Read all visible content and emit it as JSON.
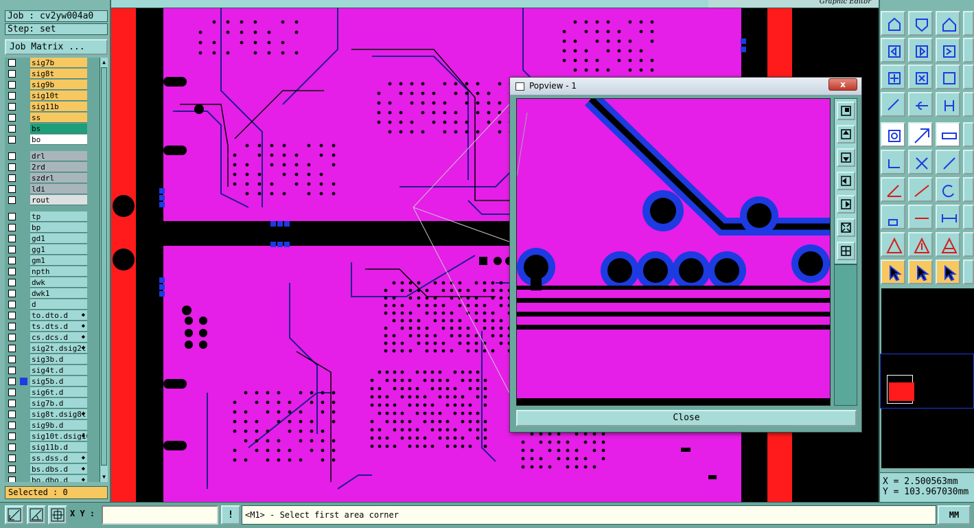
{
  "job": {
    "label": "Job : cv2yw004a0",
    "step": "Step: set",
    "matrix_button": "Job Matrix ..."
  },
  "layers": [
    {
      "name": "sig7b",
      "color": "#f7c760",
      "mark": ""
    },
    {
      "name": "sig8t",
      "color": "#f7c760",
      "mark": ""
    },
    {
      "name": "sig9b",
      "color": "#f7c760",
      "mark": ""
    },
    {
      "name": "sig10t",
      "color": "#f7c760",
      "mark": ""
    },
    {
      "name": "sig11b",
      "color": "#f7c760",
      "mark": ""
    },
    {
      "name": "ss",
      "color": "#f7c760",
      "mark": ""
    },
    {
      "name": "bs",
      "color": "#1f9e7a",
      "mark": ""
    },
    {
      "name": "bo",
      "color": "#ffffff",
      "mark": ""
    },
    {
      "name": "drl",
      "color": "#a8b6bc",
      "mark": ""
    },
    {
      "name": "2rd",
      "color": "#a8b6bc",
      "mark": ""
    },
    {
      "name": "szdrl",
      "color": "#a8b6bc",
      "mark": ""
    },
    {
      "name": "ldi",
      "color": "#a8b6bc",
      "mark": ""
    },
    {
      "name": "rout",
      "color": "#dde0e0",
      "mark": ""
    },
    {
      "name": "tp",
      "color": "#9fd8d4",
      "mark": ""
    },
    {
      "name": "bp",
      "color": "#9fd8d4",
      "mark": ""
    },
    {
      "name": "gd1",
      "color": "#9fd8d4",
      "mark": ""
    },
    {
      "name": "gg1",
      "color": "#9fd8d4",
      "mark": ""
    },
    {
      "name": "gm1",
      "color": "#9fd8d4",
      "mark": ""
    },
    {
      "name": "npth",
      "color": "#9fd8d4",
      "mark": ""
    },
    {
      "name": "dwk",
      "color": "#9fd8d4",
      "mark": ""
    },
    {
      "name": "dwk1",
      "color": "#9fd8d4",
      "mark": ""
    },
    {
      "name": "d",
      "color": "#9fd8d4",
      "mark": ""
    },
    {
      "name": "to.d",
      "color": "#9fd8d4",
      "mark": "◆"
    },
    {
      "name": "ts.d",
      "color": "#9fd8d4",
      "mark": "◆"
    },
    {
      "name": "cs.d",
      "color": "#9fd8d4",
      "mark": "◆"
    },
    {
      "name": "sig2t.d",
      "color": "#9fd8d4",
      "mark": "◆"
    },
    {
      "name": "sig3b.d",
      "color": "#9fd8d4",
      "mark": ""
    },
    {
      "name": "sig4t.d",
      "color": "#9fd8d4",
      "mark": ""
    },
    {
      "name": "sig5b.d",
      "color": "#9fd8d4",
      "mark": "",
      "selected": true
    },
    {
      "name": "sig6t.d",
      "color": "#9fd8d4",
      "mark": ""
    },
    {
      "name": "sig7b.d",
      "color": "#9fd8d4",
      "mark": ""
    },
    {
      "name": "sig8t.d",
      "color": "#9fd8d4",
      "mark": "◆"
    },
    {
      "name": "sig9b.d",
      "color": "#9fd8d4",
      "mark": ""
    },
    {
      "name": "sig10t.d",
      "color": "#9fd8d4",
      "mark": "◆"
    },
    {
      "name": "sig11b.d",
      "color": "#9fd8d4",
      "mark": ""
    },
    {
      "name": "ss.d",
      "color": "#9fd8d4",
      "mark": "◆"
    },
    {
      "name": "bs.d",
      "color": "#9fd8d4",
      "mark": "◆"
    },
    {
      "name": "bo.d",
      "color": "#9fd8d4",
      "mark": "◆"
    }
  ],
  "selected_label": "Selected : 0",
  "popview": {
    "title": "Popview - 1",
    "close_x": "x",
    "close_button": "Close"
  },
  "right": {
    "strip_title": "Graphic Editor"
  },
  "coords": {
    "x": "X = 2.500563mm",
    "y": "Y = 103.967030mm"
  },
  "bottom": {
    "xy_label": "X Y :",
    "xy_value": "",
    "warn": "!",
    "prompt": "<M1> - Select first area corner",
    "unit": "MM"
  },
  "colors": {
    "board": "#e51ee8",
    "feature": "#000000",
    "pad_ring": "#1d3be0",
    "rail": "#ff1b1b",
    "ui": "#9fd8d4"
  }
}
